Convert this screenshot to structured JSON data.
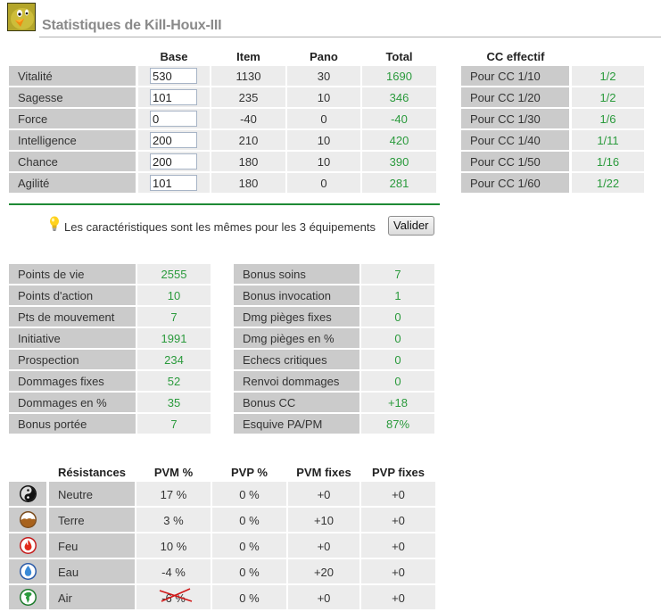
{
  "header": {
    "title": "Statistiques de Kill-Houx-III",
    "avatar_icon": "chick-avatar-icon"
  },
  "characteristics": {
    "columns": [
      "Base",
      "Item",
      "Pano",
      "Total"
    ],
    "rows": [
      {
        "label": "Vitalité",
        "base": "530",
        "item": "1130",
        "pano": "30",
        "total": "1690"
      },
      {
        "label": "Sagesse",
        "base": "101",
        "item": "235",
        "pano": "10",
        "total": "346"
      },
      {
        "label": "Force",
        "base": "0",
        "item": "-40",
        "pano": "0",
        "total": "-40"
      },
      {
        "label": "Intelligence",
        "base": "200",
        "item": "210",
        "pano": "10",
        "total": "420"
      },
      {
        "label": "Chance",
        "base": "200",
        "item": "180",
        "pano": "10",
        "total": "390"
      },
      {
        "label": "Agilité",
        "base": "101",
        "item": "180",
        "pano": "0",
        "total": "281"
      }
    ]
  },
  "cc": {
    "header": "CC effectif",
    "rows": [
      {
        "label": "Pour CC 1/10",
        "value": "1/2"
      },
      {
        "label": "Pour CC 1/20",
        "value": "1/2"
      },
      {
        "label": "Pour CC 1/30",
        "value": "1/6"
      },
      {
        "label": "Pour CC 1/40",
        "value": "1/11"
      },
      {
        "label": "Pour CC 1/50",
        "value": "1/16"
      },
      {
        "label": "Pour CC 1/60",
        "value": "1/22"
      }
    ]
  },
  "notice": {
    "icon": "lightbulb-icon",
    "text": "Les caractéristiques sont les mêmes pour les 3 équipements",
    "button_label": "Valider"
  },
  "stats_left": [
    {
      "label": "Points de vie",
      "value": "2555"
    },
    {
      "label": "Points d'action",
      "value": "10"
    },
    {
      "label": "Pts de mouvement",
      "value": "7"
    },
    {
      "label": "Initiative",
      "value": "1991"
    },
    {
      "label": "Prospection",
      "value": "234"
    },
    {
      "label": "Dommages fixes",
      "value": "52"
    },
    {
      "label": "Dommages en %",
      "value": "35"
    },
    {
      "label": "Bonus portée",
      "value": "7"
    }
  ],
  "stats_right": [
    {
      "label": "Bonus soins",
      "value": "7"
    },
    {
      "label": "Bonus invocation",
      "value": "1"
    },
    {
      "label": "Dmg pièges fixes",
      "value": "0"
    },
    {
      "label": "Dmg pièges en %",
      "value": "0"
    },
    {
      "label": "Echecs critiques",
      "value": "0"
    },
    {
      "label": "Renvoi dommages",
      "value": "0"
    },
    {
      "label": "Bonus CC",
      "value": "+18"
    },
    {
      "label": "Esquive PA/PM",
      "value": "87%"
    }
  ],
  "resistances": {
    "columns": [
      "Résistances",
      "PVM %",
      "PVP %",
      "PVM fixes",
      "PVP fixes"
    ],
    "rows": [
      {
        "element": "Neutre",
        "icon": "neutral-yinyang-icon",
        "pvm_pct": "17 %",
        "pvp_pct": "0 %",
        "pvm_fixed": "+0",
        "pvp_fixed": "+0",
        "struck": false
      },
      {
        "element": "Terre",
        "icon": "earth-icon",
        "pvm_pct": "3 %",
        "pvp_pct": "0 %",
        "pvm_fixed": "+10",
        "pvp_fixed": "+0",
        "struck": false
      },
      {
        "element": "Feu",
        "icon": "fire-icon",
        "pvm_pct": "10 %",
        "pvp_pct": "0 %",
        "pvm_fixed": "+0",
        "pvp_fixed": "+0",
        "struck": false
      },
      {
        "element": "Eau",
        "icon": "water-icon",
        "pvm_pct": "-4 %",
        "pvp_pct": "0 %",
        "pvm_fixed": "+20",
        "pvp_fixed": "+0",
        "struck": false
      },
      {
        "element": "Air",
        "icon": "air-icon",
        "pvm_pct": "-6 %",
        "pvp_pct": "0 %",
        "pvm_fixed": "+0",
        "pvp_fixed": "+0",
        "struck": true
      }
    ]
  },
  "colors": {
    "value_green": "#2a9a3c",
    "rule_green": "#1e8a35",
    "label_bg": "#cbcbcb",
    "value_bg": "#ececec",
    "title_gray": "#8a8a8a"
  }
}
